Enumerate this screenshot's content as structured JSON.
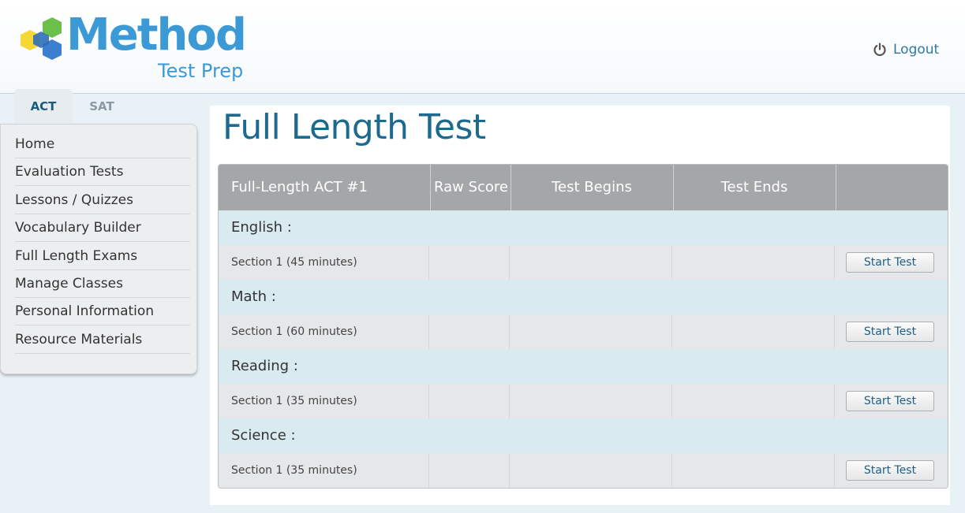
{
  "brand": {
    "name": "Method",
    "tagline": "Test Prep"
  },
  "header": {
    "logout_label": "Logout"
  },
  "tabs": [
    {
      "label": "ACT",
      "active": true
    },
    {
      "label": "SAT",
      "active": false
    }
  ],
  "sidebar": {
    "items": [
      {
        "label": "Home"
      },
      {
        "label": "Evaluation Tests"
      },
      {
        "label": "Lessons / Quizzes"
      },
      {
        "label": "Vocabulary Builder"
      },
      {
        "label": "Full Length Exams"
      },
      {
        "label": "Manage Classes"
      },
      {
        "label": "Personal Information"
      },
      {
        "label": "Resource Materials"
      }
    ]
  },
  "main": {
    "title": "Full Length Test",
    "table": {
      "headers": [
        "Full-Length ACT #1",
        "Raw Score",
        "Test Begins",
        "Test Ends",
        ""
      ],
      "groups": [
        {
          "subject": "English :",
          "section": "Section 1 (45 minutes)",
          "raw_score": "",
          "begins": "",
          "ends": "",
          "button": "Start Test"
        },
        {
          "subject": "Math :",
          "section": "Section 1 (60 minutes)",
          "raw_score": "",
          "begins": "",
          "ends": "",
          "button": "Start Test"
        },
        {
          "subject": "Reading :",
          "section": "Section 1 (35 minutes)",
          "raw_score": "",
          "begins": "",
          "ends": "",
          "button": "Start Test"
        },
        {
          "subject": "Science :",
          "section": "Section 1 (35 minutes)",
          "raw_score": "",
          "begins": "",
          "ends": "",
          "button": "Start Test"
        }
      ]
    }
  },
  "colors": {
    "accent": "#1e6a8e",
    "logo_blue": "#3b9ad6",
    "logo_green": "#6dbf4b",
    "logo_yellow": "#f5d738",
    "table_header": "#a4a6a8",
    "subject_row": "#d9eaf0"
  }
}
